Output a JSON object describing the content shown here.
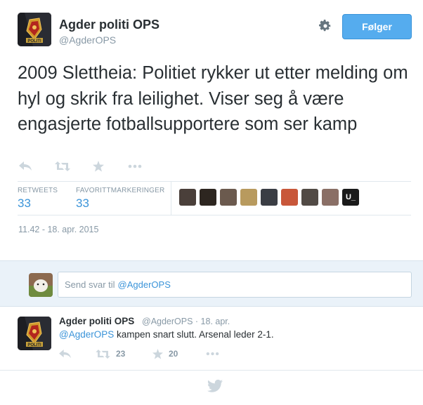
{
  "tweet": {
    "author_name": "Agder politi OPS",
    "author_handle": "@AgderOPS",
    "follow_label": "Følger",
    "text": "2009 Slettheia: Politiet rykker ut etter melding om hyl og skrik fra leilighet. Viser seg å være engasjerte fotballsupportere som ser kamp",
    "avatar_badge_text": "POLITI",
    "actions": [
      "reply-icon",
      "retweet-icon",
      "favorite-icon",
      "more-icon"
    ],
    "stats": {
      "retweets_label": "RETWEETS",
      "retweets_value": "33",
      "favorites_label": "FAVORITTMARKERINGER",
      "favorites_value": "33"
    },
    "favoriters": [
      "#4a3f3a",
      "#2d2620",
      "#6b5a4e",
      "#b89a5e",
      "#3a3d44",
      "#c8573a",
      "#514a45",
      "#8a6f66",
      "#1a1a1a"
    ],
    "favoriter_last_label": "U_",
    "timestamp": "11.42 - 18. apr. 2015"
  },
  "reply_composer": {
    "placeholder_prefix": "Send svar til",
    "placeholder_mention": "@AgderOPS"
  },
  "reply": {
    "author_name": "Agder politi OPS",
    "meta": "@AgderOPS · 18. apr.",
    "mention": "@AgderOPS",
    "text": " kampen snart slutt. Arsenal leder 2-1.",
    "retweets": "23",
    "favorites": "20"
  },
  "colors": {
    "accent": "#55acee",
    "link": "#3b94d9",
    "muted": "#8899a6",
    "reply_bg": "#eaf2f9"
  }
}
